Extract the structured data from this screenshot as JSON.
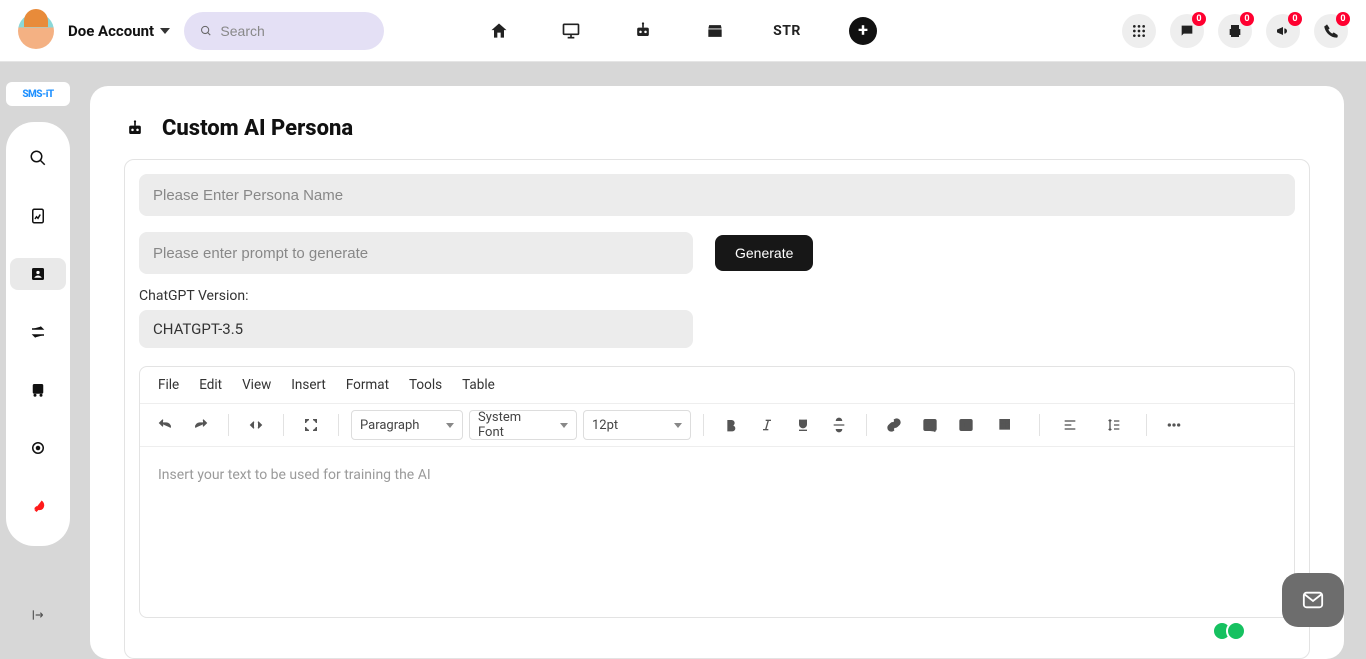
{
  "header": {
    "account_name": "Doe Account",
    "search_placeholder": "Search",
    "str_label": "STR",
    "badges": {
      "chat": "0",
      "print": "0",
      "announce": "0",
      "phone": "0"
    }
  },
  "sidebar": {
    "brand": "SMS-iT"
  },
  "page": {
    "title": "Custom AI Persona",
    "persona_name_placeholder": "Please Enter Persona Name",
    "prompt_placeholder": "Please enter prompt to generate",
    "generate_label": "Generate",
    "version_label": "ChatGPT Version:",
    "version_value": "CHATGPT-3.5"
  },
  "editor": {
    "menus": {
      "file": "File",
      "edit": "Edit",
      "view": "View",
      "insert": "Insert",
      "format": "Format",
      "tools": "Tools",
      "table": "Table"
    },
    "block_format": "Paragraph",
    "font_family": "System Font",
    "font_size": "12pt",
    "placeholder": "Insert your text to be used for training the AI"
  }
}
